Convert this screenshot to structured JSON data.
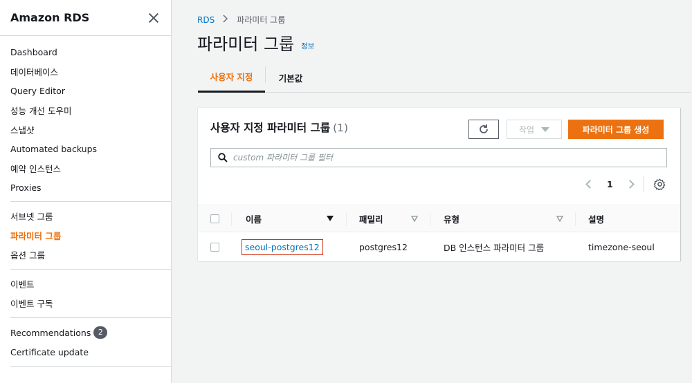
{
  "sidebar": {
    "title": "Amazon RDS",
    "groups": [
      [
        "Dashboard",
        "데이터베이스",
        "Query Editor",
        "성능 개선 도우미",
        "스냅샷",
        "Automated backups",
        "예약 인스턴스",
        "Proxies"
      ],
      [
        "서브넷 그룹",
        "파라미터 그룹",
        "옵션 그룹"
      ],
      [
        "이벤트",
        "이벤트 구독"
      ],
      [
        "Recommendations",
        "Certificate update"
      ]
    ],
    "active_item": "파라미터 그룹",
    "recommendations_badge": "2"
  },
  "breadcrumb": {
    "root": "RDS",
    "current": "파라미터 그룹"
  },
  "page": {
    "title": "파라미터 그룹",
    "info_link": "정보"
  },
  "tabs": [
    {
      "label": "사용자 지정",
      "active": true
    },
    {
      "label": "기본값",
      "active": false
    }
  ],
  "panel": {
    "title": "사용자 지정 파라미터 그룹",
    "count": "(1)",
    "action_button": "작업",
    "create_button": "파라미터 그룹 생성",
    "search_placeholder": "custom 파라미터 그룹 필터",
    "page_number": "1"
  },
  "table": {
    "columns": [
      "이름",
      "패밀리",
      "유형",
      "설명"
    ],
    "rows": [
      {
        "name": "seoul-postgres12",
        "family": "postgres12",
        "type": "DB 인스턴스 파라미터 그룹",
        "description": "timezone-seoul"
      }
    ]
  },
  "colors": {
    "accent": "#ec7211",
    "link": "#0073bb",
    "highlight_border": "#d13212"
  }
}
